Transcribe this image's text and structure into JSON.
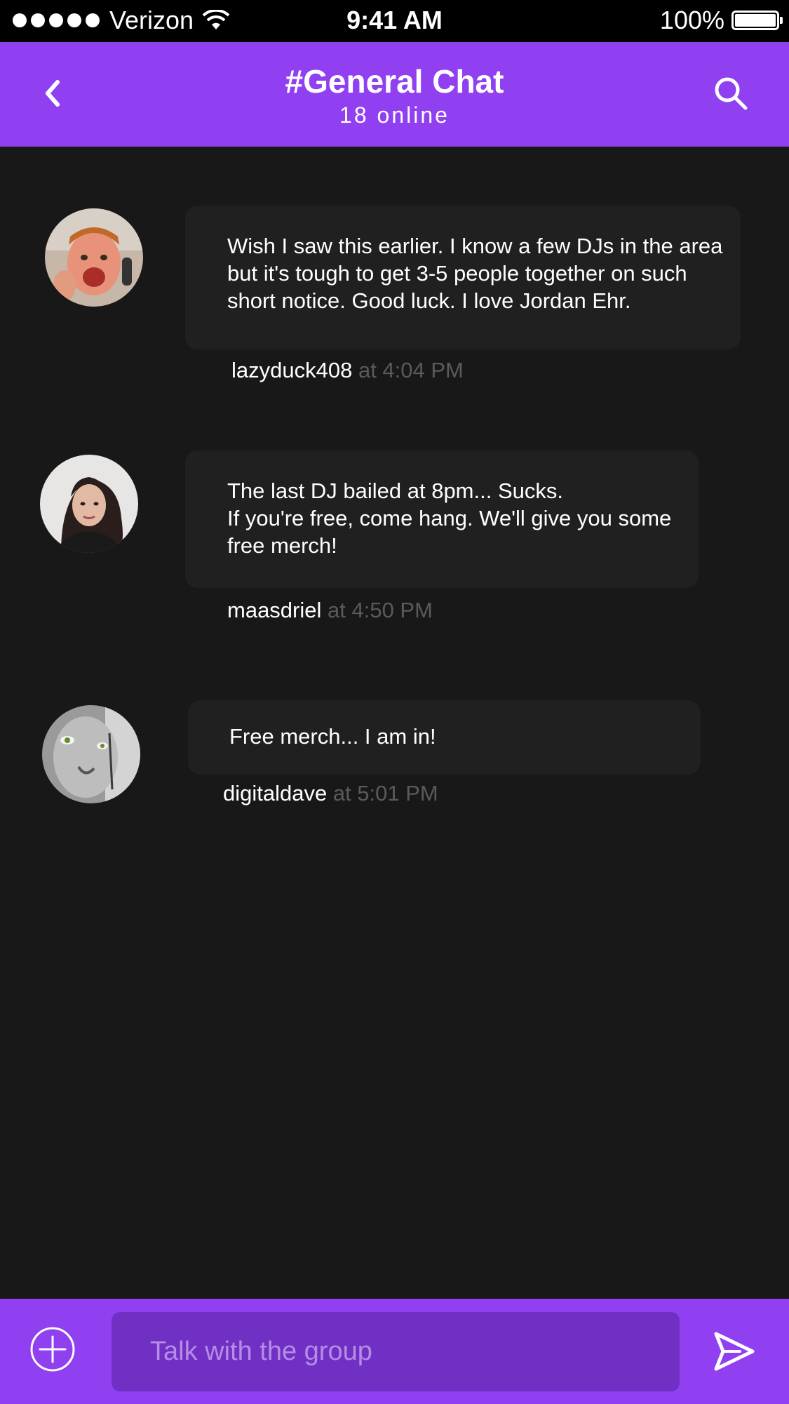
{
  "status_bar": {
    "carrier": "Verizon",
    "time": "9:41 AM",
    "battery": "100%"
  },
  "header": {
    "title": "#General Chat",
    "subtitle": "18 online",
    "back_icon": "chevron-left-icon",
    "search_icon": "search-icon"
  },
  "messages": [
    {
      "text": "Wish I saw this earlier. I know a few DJs in the area but it's tough to get 3-5 people together on such short notice. Good luck. I love Jordan Ehr.",
      "username": "lazyduck408",
      "time": "at 4:04 PM"
    },
    {
      "text": "The last DJ bailed at 8pm... Sucks.\nIf you're free, come hang. We'll give you some free merch!",
      "username": "maasdriel",
      "time": "at 4:50 PM"
    },
    {
      "text": "Free merch... I am in!",
      "username": "digitaldave",
      "time": "at 5:01 PM"
    }
  ],
  "composer": {
    "placeholder": "Talk with the group",
    "add_icon": "plus-circle-icon",
    "send_icon": "send-icon"
  },
  "colors": {
    "brand_purple": "#9040f0",
    "input_purple": "#7030c4",
    "background": "#181818",
    "bubble": "#202020",
    "timestamp": "#5a5a5a"
  }
}
